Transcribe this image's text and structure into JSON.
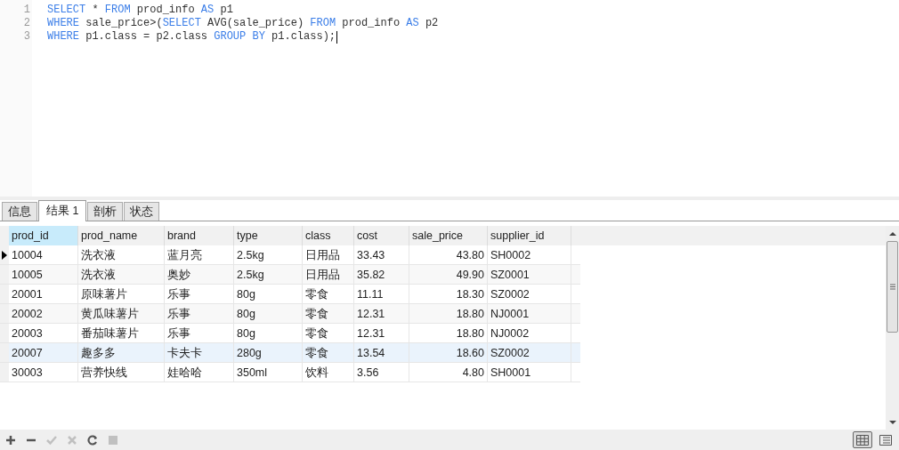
{
  "editor": {
    "lines": [
      {
        "number": "1",
        "tokens": [
          {
            "kind": "keyword",
            "text": "SELECT"
          },
          {
            "kind": "text",
            "text": " * "
          },
          {
            "kind": "keyword",
            "text": "FROM"
          },
          {
            "kind": "text",
            "text": " prod_info "
          },
          {
            "kind": "keyword",
            "text": "AS"
          },
          {
            "kind": "text",
            "text": " p1"
          }
        ]
      },
      {
        "number": "2",
        "tokens": [
          {
            "kind": "keyword",
            "text": "WHERE"
          },
          {
            "kind": "text",
            "text": " sale_price>("
          },
          {
            "kind": "keyword",
            "text": "SELECT"
          },
          {
            "kind": "text",
            "text": " AVG(sale_price) "
          },
          {
            "kind": "keyword",
            "text": "FROM"
          },
          {
            "kind": "text",
            "text": " prod_info "
          },
          {
            "kind": "keyword",
            "text": "AS"
          },
          {
            "kind": "text",
            "text": " p2"
          }
        ]
      },
      {
        "number": "3",
        "tokens": [
          {
            "kind": "keyword",
            "text": "WHERE"
          },
          {
            "kind": "text",
            "text": " p1.class = p2.class "
          },
          {
            "kind": "keyword",
            "text": "GROUP BY"
          },
          {
            "kind": "text",
            "text": " p1.class);"
          }
        ],
        "cursor": true
      }
    ]
  },
  "tabs": [
    {
      "label": "信息",
      "selected": false
    },
    {
      "label": "结果 1",
      "selected": true
    },
    {
      "label": "剖析",
      "selected": false
    },
    {
      "label": "状态",
      "selected": false
    }
  ],
  "table": {
    "columns": [
      {
        "label": "prod_id",
        "focused": true,
        "kind": "text"
      },
      {
        "label": "prod_name",
        "focused": false,
        "kind": "text"
      },
      {
        "label": "brand",
        "focused": false,
        "kind": "text"
      },
      {
        "label": "type",
        "focused": false,
        "kind": "text"
      },
      {
        "label": "class",
        "focused": false,
        "kind": "text"
      },
      {
        "label": "cost",
        "focused": false,
        "kind": "text"
      },
      {
        "label": "sale_price",
        "focused": false,
        "kind": "amount"
      },
      {
        "label": "supplier_id",
        "focused": false,
        "kind": "text"
      }
    ],
    "rows": [
      {
        "selected": true,
        "hovered": false,
        "cells": [
          "10004",
          "洗衣液",
          "蓝月亮",
          "2.5kg",
          "日用品",
          "33.43",
          "43.80",
          "SH0002"
        ]
      },
      {
        "selected": false,
        "hovered": false,
        "cells": [
          "10005",
          "洗衣液",
          "奥妙",
          "2.5kg",
          "日用品",
          "35.82",
          "49.90",
          "SZ0001"
        ]
      },
      {
        "selected": false,
        "hovered": false,
        "cells": [
          "20001",
          "原味薯片",
          "乐事",
          "80g",
          "零食",
          "11.11",
          "18.30",
          "SZ0002"
        ]
      },
      {
        "selected": false,
        "hovered": false,
        "cells": [
          "20002",
          "黄瓜味薯片",
          "乐事",
          "80g",
          "零食",
          "12.31",
          "18.80",
          "NJ0001"
        ]
      },
      {
        "selected": false,
        "hovered": false,
        "cells": [
          "20003",
          "番茄味薯片",
          "乐事",
          "80g",
          "零食",
          "12.31",
          "18.80",
          "NJ0002"
        ]
      },
      {
        "selected": false,
        "hovered": true,
        "cells": [
          "20007",
          "趣多多",
          "卡夫卡",
          "280g",
          "零食",
          "13.54",
          "18.60",
          "SZ0002"
        ]
      },
      {
        "selected": false,
        "hovered": false,
        "cells": [
          "30003",
          "营养快线",
          "娃哈哈",
          "350ml",
          "饮料",
          "3.56",
          "4.80",
          "SH0001"
        ]
      }
    ]
  },
  "toolbar": [
    {
      "kind": "add",
      "disabled": false
    },
    {
      "kind": "delete",
      "disabled": false
    },
    {
      "kind": "apply",
      "disabled": true
    },
    {
      "kind": "discard",
      "disabled": true
    },
    {
      "kind": "refresh",
      "disabled": false
    },
    {
      "kind": "stop",
      "disabled": true
    }
  ],
  "views": [
    {
      "kind": "grid",
      "selected": true
    },
    {
      "kind": "form",
      "selected": false
    }
  ]
}
